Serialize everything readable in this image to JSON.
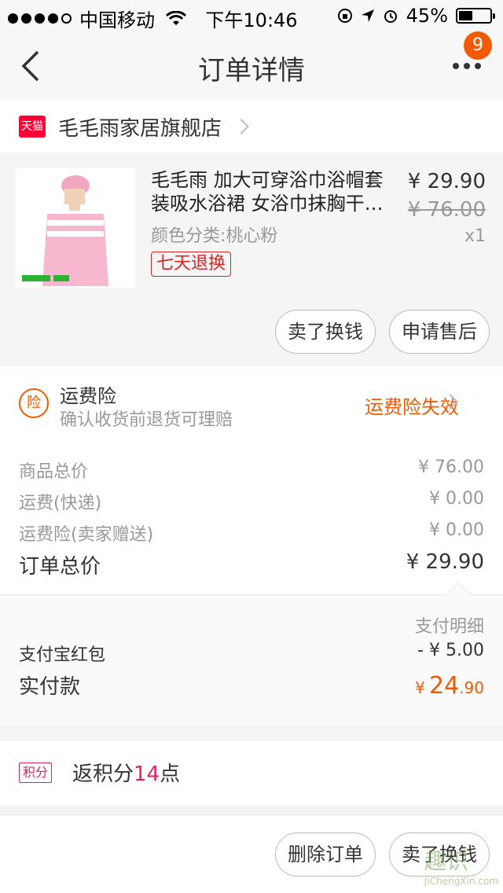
{
  "status_bar": {
    "carrier": "中国移动",
    "time": "下午10:46",
    "battery": "45%"
  },
  "nav": {
    "title": "订单详情",
    "badge": "9"
  },
  "store": {
    "name": "毛毛雨家居旗舰店",
    "platform_icon": "天猫"
  },
  "product": {
    "title": "毛毛雨 加大可穿浴巾浴帽套装吸水浴裙 女浴巾抹胸干…",
    "variant": "颜色分类:桃心粉",
    "tag": "七天退换",
    "price": "¥ 29.90",
    "original_price": "¥ 76.00",
    "quantity": "x1",
    "buttons": [
      "卖了换钱",
      "申请售后"
    ]
  },
  "insurance": {
    "icon": "险",
    "title": "运费险",
    "subtitle": "确认收货前退货可理赔",
    "status": "运费险失效"
  },
  "summary": {
    "rows": [
      {
        "label": "商品总价",
        "value": "¥ 76.00"
      },
      {
        "label": "运费(快递)",
        "value": "¥ 0.00"
      },
      {
        "label": "运费险(卖家赠送)",
        "value": "¥ 0.00"
      }
    ],
    "total_label": "订单总价",
    "total_value": "¥ 29.90"
  },
  "payment": {
    "header": "支付明细",
    "discount_label": "支付宝红包",
    "discount_value": "- ¥ 5.00",
    "paid_label": "实付款",
    "paid_currency": "¥",
    "paid_int": "24",
    "paid_dec": ".90"
  },
  "points": {
    "badge": "积分",
    "prefix": "返积分",
    "count": "14",
    "suffix": "点"
  },
  "bottom": {
    "buttons": [
      "删除订单",
      "卖了换钱"
    ]
  },
  "watermark": {
    "text": "趣识",
    "sub": "JiChengXin.com"
  },
  "colors": {
    "accent": "#f15a00",
    "tmall": "#ff0036",
    "points": "#e0245e"
  }
}
